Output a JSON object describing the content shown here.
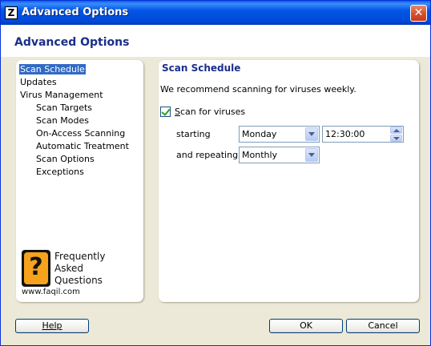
{
  "window": {
    "title": "Advanced Options",
    "close_glyph": "✕",
    "app_icon_glyph": "Z"
  },
  "header": {
    "title": "Advanced Options"
  },
  "nav": {
    "items": [
      {
        "label": "Scan Schedule",
        "level": 1,
        "selected": true
      },
      {
        "label": "Updates",
        "level": 1
      },
      {
        "label": "Virus Management",
        "level": 1
      },
      {
        "label": "Scan Targets",
        "level": 2
      },
      {
        "label": "Scan Modes",
        "level": 2
      },
      {
        "label": "On-Access Scanning",
        "level": 2
      },
      {
        "label": "Automatic Treatment",
        "level": 2
      },
      {
        "label": "Scan Options",
        "level": 2
      },
      {
        "label": "Exceptions",
        "level": 2
      }
    ]
  },
  "faq": {
    "glyph": "?",
    "line1": "Frequently",
    "line2": "Asked",
    "line3": "Questions",
    "url": "www.faqil.com"
  },
  "main": {
    "section_title": "Scan Schedule",
    "description": "We recommend scanning for viruses weekly.",
    "scan_checkbox": {
      "label_first": "S",
      "label_rest": "can for viruses",
      "checked": true
    },
    "starting_label": "starting",
    "starting_day": "Monday",
    "starting_time": "12:30:00",
    "repeating_label": "and repeating",
    "repeating_value": "Monthly"
  },
  "footer": {
    "help": "Help",
    "ok": "OK",
    "cancel": "Cancel"
  }
}
